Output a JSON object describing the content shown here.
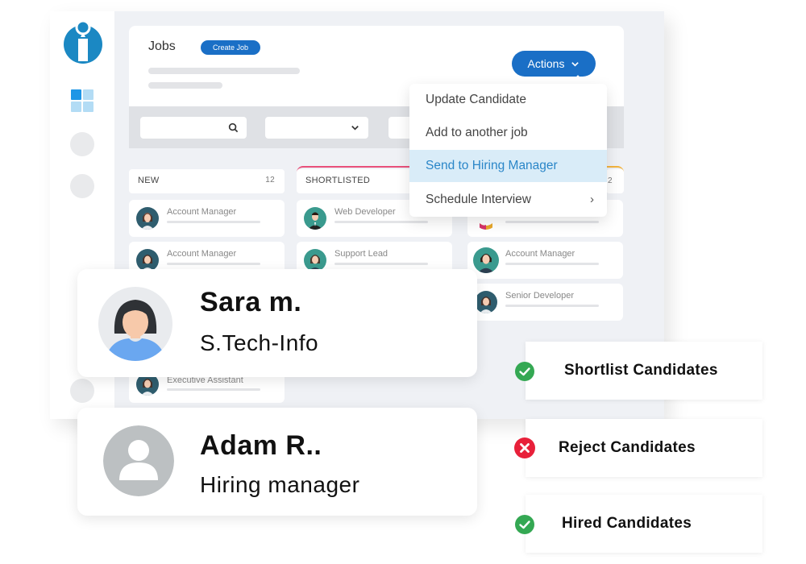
{
  "header": {
    "title": "Jobs",
    "create_job_label": "Create Job",
    "actions_label": "Actions"
  },
  "sidebar": {
    "logo": "brand-logo-icon",
    "items": [
      {
        "icon": "dashboard-grid-icon"
      },
      {
        "icon": "nav-placeholder-icon"
      },
      {
        "icon": "nav-placeholder-icon"
      },
      {
        "icon": "nav-placeholder-icon"
      }
    ]
  },
  "filters": {
    "search_placeholder": "",
    "search_icon": "search-icon",
    "dropdown_value": "",
    "dropdown_icon": "chevron-down-icon"
  },
  "actions_menu": {
    "items": [
      {
        "label": "Update Candidate",
        "active": false
      },
      {
        "label": "Add to another job",
        "active": false
      },
      {
        "label": "Send to Hiring Manager",
        "active": true
      },
      {
        "label": "Schedule Interview",
        "active": false,
        "submenu": true
      }
    ]
  },
  "columns": [
    {
      "name": "NEW",
      "count": "12",
      "accent": "",
      "cards": [
        "Account Manager",
        "Account Manager",
        "Executive Assistant"
      ]
    },
    {
      "name": "SHORTLISTED",
      "count": "",
      "accent": "#e8507a",
      "cards": [
        "Web Developer",
        "Support Lead"
      ]
    },
    {
      "name": "",
      "count": "2",
      "accent": "#f3b33d",
      "cards": [
        "",
        "Account Manager",
        "Senior Developer"
      ]
    }
  ],
  "people": [
    {
      "name": "Sara m.",
      "role": "S.Tech-Info",
      "avatar": "female-avatar-icon"
    },
    {
      "name": "Adam R..",
      "role": "Hiring manager",
      "avatar": "generic-user-avatar-icon"
    }
  ],
  "status_actions": [
    {
      "label": "Shortlist Candidates",
      "icon": "check-circle-icon",
      "color": "#34a853"
    },
    {
      "label": "Reject Candidates",
      "icon": "x-circle-icon",
      "color": "#e8203a"
    },
    {
      "label": "Hired Candidates",
      "icon": "check-circle-icon",
      "color": "#34a853"
    }
  ],
  "colors": {
    "primary": "#1a6fc6",
    "menu_active_bg": "#d9ecf8",
    "menu_active_text": "#2a86c8"
  }
}
